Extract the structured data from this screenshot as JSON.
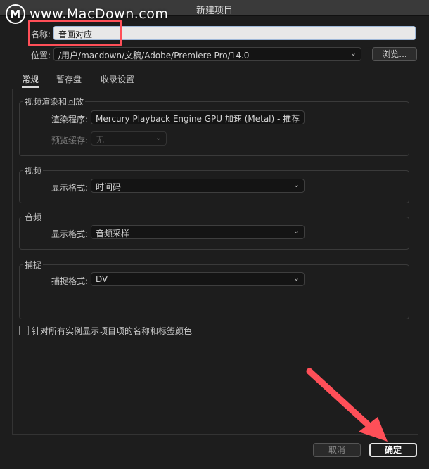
{
  "window": {
    "title": "新建项目"
  },
  "watermark": {
    "logo": "M",
    "text": "www.MacDown.com"
  },
  "name_row": {
    "label": "名称:",
    "value": "音画对应"
  },
  "location_row": {
    "label": "位置:",
    "value": "/用户/macdown/文稿/Adobe/Premiere Pro/14.0",
    "browse": "浏览..."
  },
  "tabs": [
    "常规",
    "暂存盘",
    "收录设置"
  ],
  "video_render": {
    "title": "视频渲染和回放",
    "renderer_label": "渲染程序:",
    "renderer_value": "Mercury Playback Engine GPU 加速 (Metal) - 推荐",
    "preview_cache_label": "预览缓存:",
    "preview_cache_value": "无"
  },
  "video": {
    "title": "视频",
    "format_label": "显示格式:",
    "format_value": "时间码"
  },
  "audio": {
    "title": "音频",
    "format_label": "显示格式:",
    "format_value": "音频采样"
  },
  "capture": {
    "title": "捕捉",
    "format_label": "捕捉格式:",
    "format_value": "DV"
  },
  "checkbox": {
    "label": "针对所有实例显示项目项的名称和标签颜色",
    "checked": false
  },
  "buttons": {
    "cancel": "取消",
    "ok": "确定"
  },
  "colors": {
    "annotation": "#ff4f58",
    "background": "#1d1d1d"
  }
}
